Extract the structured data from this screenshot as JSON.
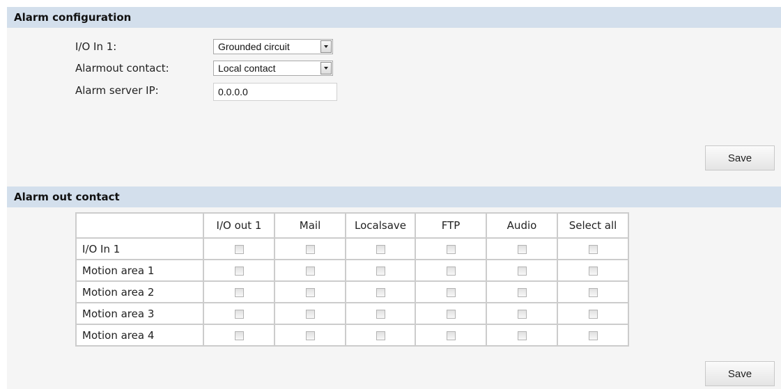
{
  "alarm_configuration": {
    "title": "Alarm configuration",
    "io_in_1": {
      "label": "I/O In 1:",
      "value": "Grounded circuit"
    },
    "alarmout_contact": {
      "label": "Alarmout contact:",
      "value": "Local contact"
    },
    "alarm_server_ip": {
      "label": "Alarm server IP:",
      "value": "0.0.0.0"
    },
    "save_label": "Save"
  },
  "alarm_out_contact": {
    "title": "Alarm out contact",
    "columns": [
      "I/O out 1",
      "Mail",
      "Localsave",
      "FTP",
      "Audio",
      "Select all"
    ],
    "rows": [
      {
        "label": "I/O In 1",
        "checked": [
          false,
          false,
          false,
          false,
          false,
          false
        ]
      },
      {
        "label": "Motion area 1",
        "checked": [
          false,
          false,
          false,
          false,
          false,
          false
        ]
      },
      {
        "label": "Motion area 2",
        "checked": [
          false,
          false,
          false,
          false,
          false,
          false
        ]
      },
      {
        "label": "Motion area 3",
        "checked": [
          false,
          false,
          false,
          false,
          false,
          false
        ]
      },
      {
        "label": "Motion area 4",
        "checked": [
          false,
          false,
          false,
          false,
          false,
          false
        ]
      }
    ],
    "save_label": "Save"
  }
}
